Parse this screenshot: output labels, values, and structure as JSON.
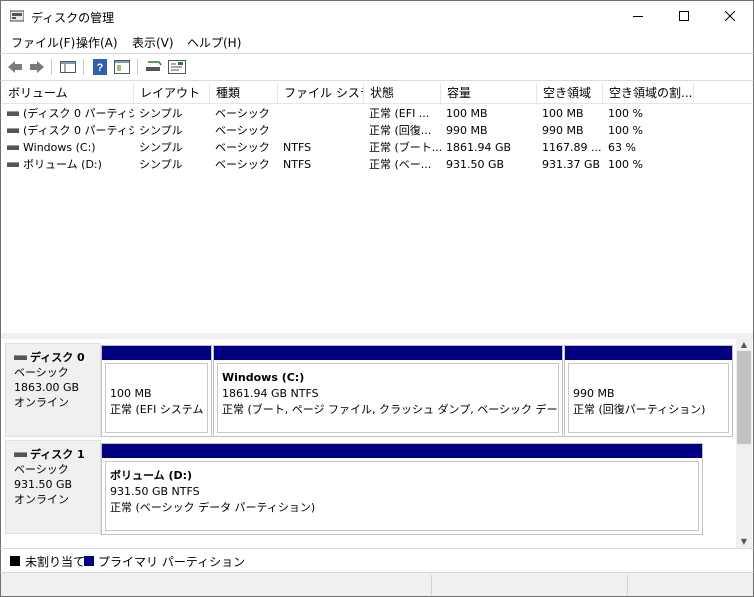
{
  "window": {
    "title": "ディスクの管理",
    "minimize_glyph": "—",
    "maximize_glyph": "☐",
    "close_glyph": "✕"
  },
  "menu": [
    "ファイル(F)",
    "操作(A)",
    "表示(V)",
    "ヘルプ(H)"
  ],
  "toolbar": {
    "buttons": [
      "back-icon",
      "forward-icon",
      "show-hide-console-tree-icon",
      "help-icon",
      "properties-icon",
      "rescan-disks-icon",
      "settings-icon"
    ]
  },
  "volume_table": {
    "headers": [
      "ボリューム",
      "レイアウト",
      "種類",
      "ファイル システム",
      "状態",
      "容量",
      "空き領域",
      "空き領域の割..."
    ],
    "rows": [
      [
        "(ディスク 0 パーティシ...",
        "シンプル",
        "ベーシック",
        "",
        "正常 (EFI ...",
        "100 MB",
        "100 MB",
        "100 %"
      ],
      [
        "(ディスク 0 パーティシ...",
        "シンプル",
        "ベーシック",
        "",
        "正常 (回復...",
        "990 MB",
        "990 MB",
        "100 %"
      ],
      [
        "Windows (C:)",
        "シンプル",
        "ベーシック",
        "NTFS",
        "正常 (ブート...",
        "1861.94 GB",
        "1167.89 ...",
        "63 %"
      ],
      [
        "ボリューム (D:)",
        "シンプル",
        "ベーシック",
        "NTFS",
        "正常 (ベー...",
        "931.50 GB",
        "931.37 GB",
        "100 %"
      ]
    ]
  },
  "disks": [
    {
      "name": "ディスク 0",
      "type": "ベーシック",
      "size": "1863.00 GB",
      "status": "オンライン",
      "partitions": [
        {
          "line1": "",
          "line2": "100 MB",
          "line3": "正常 (EFI システム パ"
        },
        {
          "line1": "Windows  (C:)",
          "line2": "1861.94 GB NTFS",
          "line3": "正常 (ブート, ページ ファイル, クラッシュ ダンプ, ベーシック データ パーティシ"
        },
        {
          "line1": "",
          "line2": "990 MB",
          "line3": "正常 (回復パーティション)"
        }
      ]
    },
    {
      "name": "ディスク 1",
      "type": "ベーシック",
      "size": "931.50 GB",
      "status": "オンライン",
      "partitions": [
        {
          "line1": "ボリューム  (D:)",
          "line2": "931.50 GB NTFS",
          "line3": "正常 (ベーシック データ パーティション)"
        }
      ]
    }
  ],
  "legend": [
    {
      "label": "未割り当て",
      "color": "#000000"
    },
    {
      "label": "プライマリ パーティション",
      "color": "#000080"
    }
  ],
  "colors": {
    "primary_partition": "#000080",
    "unallocated": "#000000"
  }
}
